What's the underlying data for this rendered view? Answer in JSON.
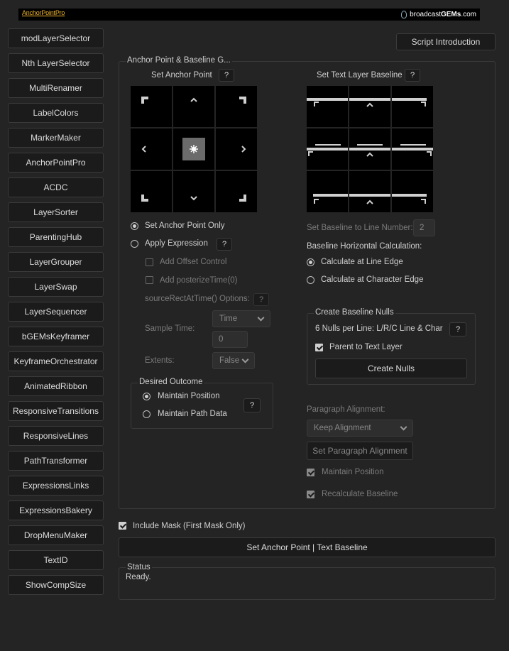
{
  "header": {
    "logo_left": "AnchorPointPro",
    "logo_right_a": "broadcast",
    "logo_right_b": "GEMs",
    "logo_right_c": ".com"
  },
  "sidebar": {
    "items": [
      {
        "label": "modLayerSelector"
      },
      {
        "label": "Nth LayerSelector"
      },
      {
        "label": "MultiRenamer"
      },
      {
        "label": "LabelColors"
      },
      {
        "label": "MarkerMaker"
      },
      {
        "label": "AnchorPointPro"
      },
      {
        "label": "ACDC"
      },
      {
        "label": "LayerSorter"
      },
      {
        "label": "ParentingHub"
      },
      {
        "label": "LayerGrouper"
      },
      {
        "label": "LayerSwap"
      },
      {
        "label": "LayerSequencer"
      },
      {
        "label": "bGEMsKeyframer"
      },
      {
        "label": "KeyframeOrchestrator"
      },
      {
        "label": "AnimatedRibbon"
      },
      {
        "label": "ResponsiveTransitions"
      },
      {
        "label": "ResponsiveLines"
      },
      {
        "label": "PathTransformer"
      },
      {
        "label": "ExpressionsLinks"
      },
      {
        "label": "ExpressionsBakery"
      },
      {
        "label": "DropMenuMaker"
      },
      {
        "label": "TextID"
      },
      {
        "label": "ShowCompSize"
      }
    ]
  },
  "script_intro": "Script Introduction",
  "main_panel": {
    "title": "Anchor Point & Baseline G...",
    "help": "?",
    "anchor": {
      "title": "Set Anchor Point",
      "mode_only": "Set Anchor Point Only",
      "mode_expr": "Apply Expression",
      "add_offset": "Add Offset Control",
      "add_posterize": "Add posterizeTime(0)",
      "source_rect": "sourceRectAtTime() Options:",
      "sample_time_label": "Sample Time:",
      "sample_time_value": "Time",
      "sample_time_num": "0",
      "extents_label": "Extents:",
      "extents_value": "False"
    },
    "outcome": {
      "title": "Desired Outcome",
      "maintain_position": "Maintain Position",
      "maintain_path": "Maintain Path Data"
    },
    "baseline": {
      "title": "Set Text Layer Baseline",
      "line_number_label": "Set Baseline to Line Number:",
      "line_number_value": "2",
      "horiz_label": "Baseline Horizontal Calculation:",
      "line_edge": "Calculate at Line Edge",
      "char_edge": "Calculate at Character Edge"
    },
    "nulls": {
      "title": "Create Baseline Nulls",
      "desc": "6 Nulls per Line: L/R/C Line & Char",
      "parent": "Parent to Text Layer",
      "create": "Create Nulls"
    },
    "paragraph": {
      "label": "Paragraph Alignment:",
      "value": "Keep Alignment",
      "set_btn": "Set Paragraph Alignment",
      "maintain": "Maintain Position",
      "recalc": "Recalculate Baseline"
    }
  },
  "include_mask": "Include Mask (First Mask Only)",
  "apply_button": "Set Anchor Point | Text Baseline",
  "status": {
    "title": "Status",
    "text": "Ready."
  }
}
